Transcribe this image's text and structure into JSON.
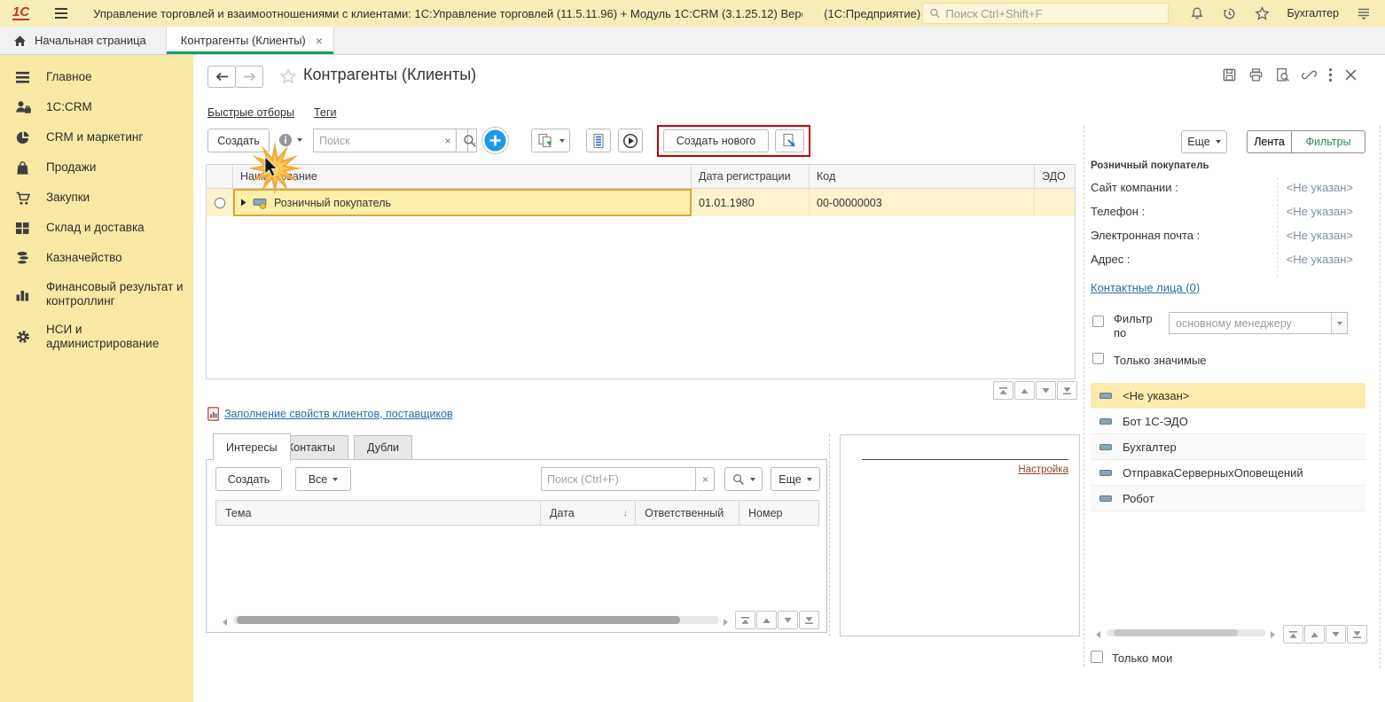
{
  "colors": {
    "accent_green": "#17a05e",
    "topbar_bg": "#f6eeb6",
    "sidebar_bg": "#f8e9a4",
    "selection_yellow": "#fcf3cc",
    "selected_cell_border": "#dfa637",
    "highlight_red": "#c40000",
    "link_blue": "#2f6ca5",
    "settings_link": "#8b4a2f"
  },
  "glyphs": {
    "close": "×",
    "ellipsis": "...",
    "sort_desc": "↓"
  },
  "titlebar": {
    "logo": "1С",
    "app_title": "Управление торговлей и взаимоотношениями с клиентами: 1С:Управление торговлей (11.5.11.96) + Модуль 1С:CRM (3.1.25.12) Версия пр...",
    "mode": "(1С:Предприятие)",
    "search_placeholder": "Поиск Ctrl+Shift+F",
    "user": "Бухгалтер"
  },
  "tabbar": {
    "home_label": "Начальная страница",
    "tab_label": "Контрагенты (Клиенты)"
  },
  "sidebar": {
    "items": [
      {
        "label": "Главное"
      },
      {
        "label": "1C:CRM"
      },
      {
        "label": "CRM и маркетинг"
      },
      {
        "label": "Продажи"
      },
      {
        "label": "Закупки"
      },
      {
        "label": "Склад и доставка"
      },
      {
        "label": "Казначейство"
      },
      {
        "label": "Финансовый результат и контроллинг"
      },
      {
        "label": "НСИ и администрирование"
      }
    ]
  },
  "main": {
    "title": "Контрагенты (Клиенты)",
    "quick_filters_link": "Быстрые отборы",
    "tags_link": "Теги",
    "toolbar": {
      "create_button": "Создать",
      "search_placeholder": "Поиск",
      "create_new_button": "Создать нового"
    },
    "table": {
      "columns": [
        "Наименование",
        "Дата регистрации",
        "Код",
        "ЭДО"
      ],
      "rows": [
        {
          "name": "Розничный покупатель",
          "reg_date": "01.01.1980",
          "code": "00-00000003",
          "edo": ""
        }
      ]
    },
    "fill_properties_link": "Заполнение свойств клиентов, поставщиков",
    "tabs": [
      "Интересы",
      "Контакты",
      "Дубли"
    ],
    "interests": {
      "create_button": "Создать",
      "all_button": "Все",
      "search_placeholder": "Поиск (Ctrl+F)",
      "more_button": "Еще",
      "columns": [
        "Тема",
        "Дата",
        "Ответственный",
        "Номер"
      ]
    },
    "settings_link": "Настройка"
  },
  "right_panel": {
    "more_button": "Еще",
    "feed_button": "Лента",
    "filters_button": "Фильтры",
    "client_name": "Розничный покупатель",
    "details": [
      {
        "label": "Сайт компании :",
        "value": "<Не указан>"
      },
      {
        "label": "Телефон :",
        "value": "<Не указан>"
      },
      {
        "label": "Электронная почта :",
        "value": "<Не указан>"
      },
      {
        "label": "Адрес :",
        "value": "<Не указан>"
      }
    ],
    "contact_persons_link": "Контактные лица (0)",
    "filter_by_label": "Фильтр по",
    "filter_by_value": "основному менеджеру",
    "only_significant_label": "Только значимые",
    "managers": [
      {
        "name": "<Не указан>"
      },
      {
        "name": "Бот 1С-ЭДО"
      },
      {
        "name": "Бухгалтер"
      },
      {
        "name": "ОтправкаСерверныхОповещений"
      },
      {
        "name": "Робот"
      }
    ],
    "only_mine_label": "Только мои"
  }
}
